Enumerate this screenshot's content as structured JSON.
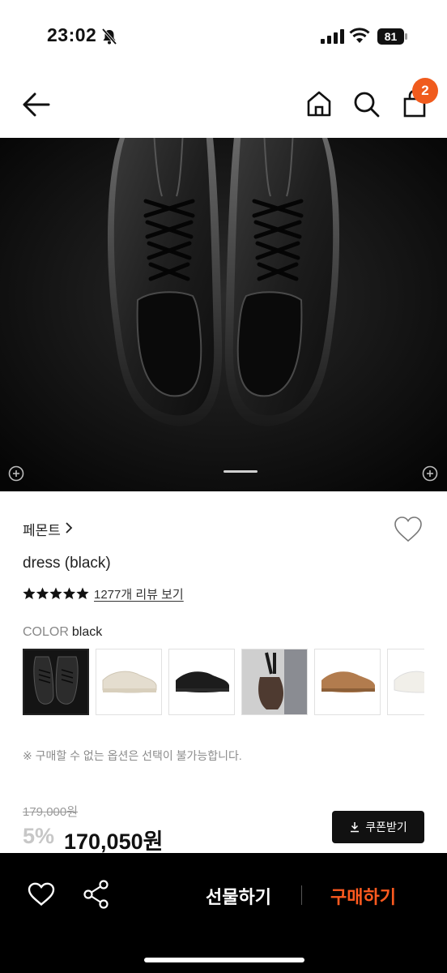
{
  "status_bar": {
    "time": "23:02",
    "battery": "81",
    "icons": [
      "bell-slash-icon",
      "signal-icon",
      "wifi-icon",
      "battery-icon"
    ]
  },
  "nav": {
    "icons": [
      "back-arrow-icon",
      "home-icon",
      "search-icon",
      "cart-icon"
    ],
    "cart_count": "2",
    "badge_color": "#f05b1d"
  },
  "hero": {
    "description_icons": [
      "left-circle-icon",
      "right-circle-icon"
    ]
  },
  "product": {
    "brand": "페몬트",
    "name": "dress (black)",
    "rating_stars": 5,
    "review_link": "1277개 리뷰 보기"
  },
  "color": {
    "label": "COLOR",
    "selected": "black",
    "options": [
      {
        "key": "black-dress",
        "color": "#1a1a1a"
      },
      {
        "key": "beige",
        "color": "#e6e0d4"
      },
      {
        "key": "black-sneaker",
        "color": "#1c1c1c"
      },
      {
        "key": "brown-photo",
        "color": "#5a4034"
      },
      {
        "key": "tan",
        "color": "#b07a4c"
      },
      {
        "key": "white",
        "color": "#f2f0ea"
      }
    ]
  },
  "notice": "※ 구매할 수 없는 옵션은 선택이 불가능합니다.",
  "price": {
    "original": "179,000원",
    "discount": "5%",
    "final": "170,050원",
    "coupon_label": "쿠폰받기"
  },
  "bottom_bar": {
    "gift_label": "선물하기",
    "buy_label": "구매하기",
    "buy_color": "#ff5a1f"
  }
}
